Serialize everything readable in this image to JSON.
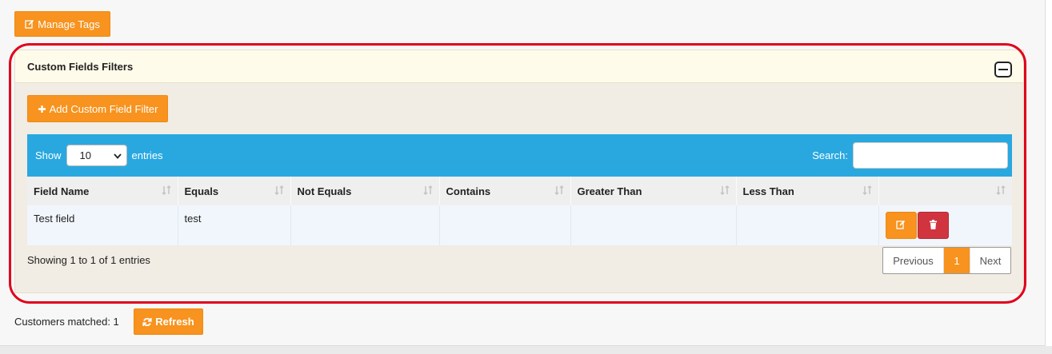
{
  "top": {
    "manage_tags_label": "Manage Tags"
  },
  "panel": {
    "title": "Custom Fields Filters",
    "add_filter_label": "Add Custom Field Filter"
  },
  "datatable": {
    "show_label": "Show",
    "entries_label": "entries",
    "page_length": "10",
    "search_label": "Search:",
    "search_value": "",
    "columns": [
      "Field Name",
      "Equals",
      "Not Equals",
      "Contains",
      "Greater Than",
      "Less Than",
      ""
    ],
    "rows": [
      {
        "field_name": "Test field",
        "equals": "test",
        "not_equals": "",
        "contains": "",
        "greater_than": "",
        "less_than": ""
      }
    ],
    "info": "Showing 1 to 1 of 1 entries",
    "pagination": {
      "previous": "Previous",
      "current": "1",
      "next": "Next"
    }
  },
  "footer": {
    "customers_matched": "Customers matched: 1",
    "refresh_label": "Refresh"
  },
  "colors": {
    "accent_orange": "#f7931e",
    "toolbar_blue": "#29a8e0",
    "delete_red": "#d0353f",
    "highlight_red": "#e0001b"
  }
}
